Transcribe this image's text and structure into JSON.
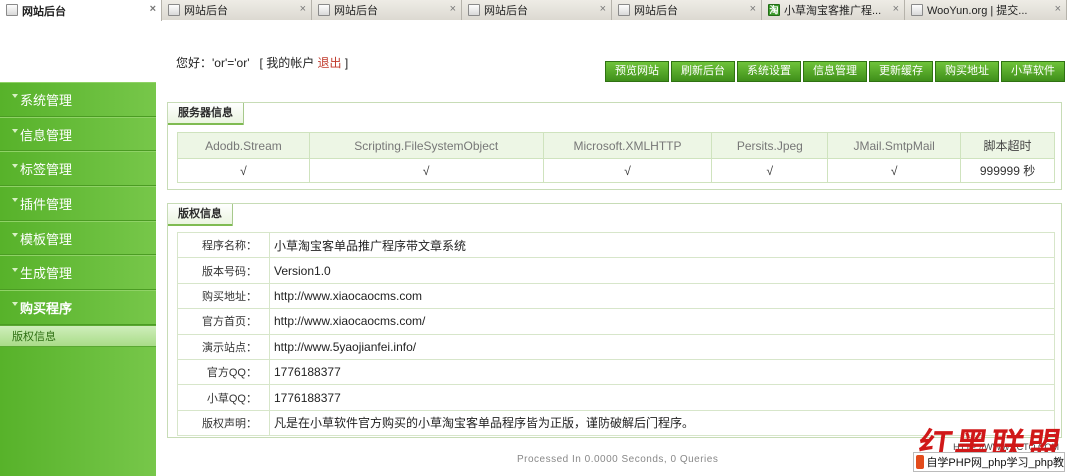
{
  "browser": {
    "tabs": [
      {
        "label": "网站后台",
        "active": true,
        "width": 162
      },
      {
        "label": "网站后台",
        "active": false,
        "width": 150
      },
      {
        "label": "网站后台",
        "active": false,
        "width": 150
      },
      {
        "label": "网站后台",
        "active": false,
        "width": 150
      },
      {
        "label": "网站后台",
        "active": false,
        "width": 150
      },
      {
        "label": "小草淘宝客推广程...",
        "active": false,
        "width": 143,
        "icon": "green"
      },
      {
        "label": "WooYun.org | 提交...",
        "active": false,
        "width": 162
      }
    ],
    "close_glyph": "×",
    "green_icon_glyph": "淘"
  },
  "header": {
    "greeting_prefix": "您好：'or'='or'",
    "account_open": "[ 我的帐户",
    "logout_label": "退出",
    "account_close": "]",
    "nav": [
      "预览网站",
      "刷新后台",
      "系统设置",
      "信息管理",
      "更新缓存",
      "购买地址",
      "小草软件"
    ]
  },
  "sidebar": {
    "items": [
      "系统管理",
      "信息管理",
      "标签管理",
      "插件管理",
      "模板管理",
      "生成管理",
      "购买程序"
    ],
    "sub_item": "版权信息"
  },
  "server_panel": {
    "title": "服务器信息",
    "columns": [
      "Adodb.Stream",
      "Scripting.FileSystemObject",
      "Microsoft.XMLHTTP",
      "Persits.Jpeg",
      "JMail.SmtpMail",
      "脚本超时"
    ],
    "values": [
      "√",
      "√",
      "√",
      "√",
      "√",
      "999999 秒"
    ]
  },
  "copyright_panel": {
    "title": "版权信息",
    "rows": [
      {
        "key": "程序名称：",
        "value": "小草淘宝客单品推广程序带文章系统"
      },
      {
        "key": "版本号码：",
        "value": "Version1.0"
      },
      {
        "key": "购买地址：",
        "value": "http://www.xiaocaocms.com"
      },
      {
        "key": "官方首页：",
        "value": "http://www.xiaocaocms.com/"
      },
      {
        "key": "演示站点：",
        "value": "http://www.5yaojianfei.info/"
      },
      {
        "key": "官方QQ：",
        "value": "1776188377"
      },
      {
        "key": "小草QQ：",
        "value": "1776188377"
      },
      {
        "key": "版权声明：",
        "value": "凡是在小草软件官方购买的小草淘宝客单品程序皆为正版，谨防破解后门程序。"
      }
    ]
  },
  "footer": "Processed In 0.0000 Seconds, 0 Queries",
  "watermark": {
    "red_text": "红黑联盟",
    "bar_text": "自学PHP网_php学习_php教",
    "small_text": "HTTP://WWW.2CTO.COM"
  }
}
